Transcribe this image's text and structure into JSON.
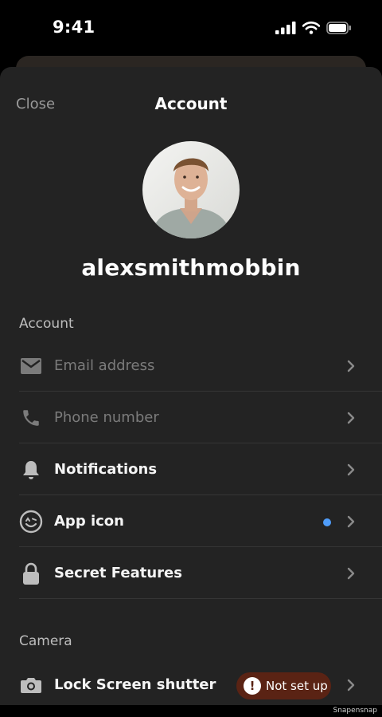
{
  "status": {
    "time": "9:41"
  },
  "nav": {
    "close_label": "Close",
    "title": "Account"
  },
  "profile": {
    "username": "alexsmithmobbin"
  },
  "sections": {
    "account": {
      "title": "Account",
      "items": [
        {
          "label": "Email address",
          "icon": "mail-icon",
          "muted": true
        },
        {
          "label": "Phone number",
          "icon": "phone-icon",
          "muted": true
        },
        {
          "label": "Notifications",
          "icon": "bell-icon",
          "muted": false
        },
        {
          "label": "App icon",
          "icon": "smiley-icon",
          "muted": false,
          "indicator": "blue-dot"
        },
        {
          "label": "Secret Features",
          "icon": "lock-icon",
          "muted": false
        }
      ]
    },
    "camera": {
      "title": "Camera",
      "items": [
        {
          "label": "Lock Screen shutter",
          "icon": "camera-icon",
          "badge": "Not set up",
          "badge_icon": "exclamation-icon"
        }
      ]
    }
  },
  "colors": {
    "background": "#232323",
    "indicator": "#4f9cf9",
    "badge_bg": "#5a2314",
    "muted_text": "#7b7b7b"
  },
  "watermark": "Snapensnap"
}
